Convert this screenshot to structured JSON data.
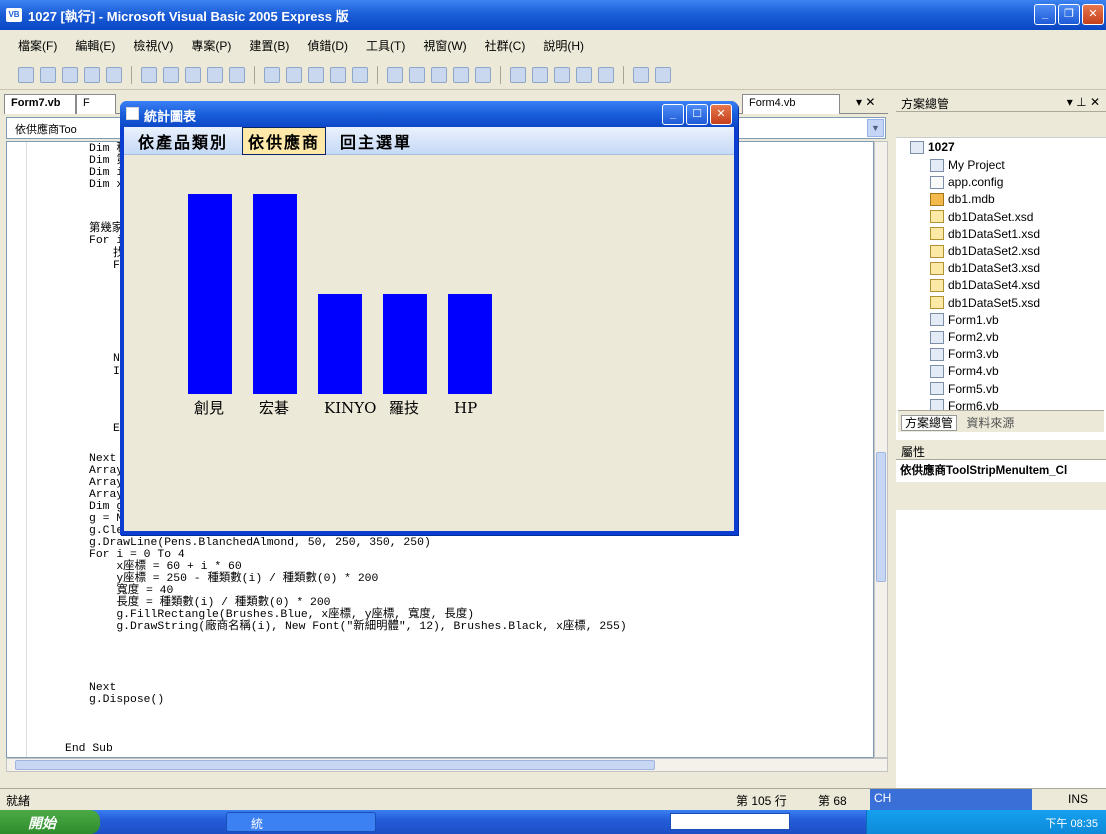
{
  "window": {
    "title": "1027 [執行] - Microsoft Visual Basic 2005 Express 版",
    "icon": "vb-app-icon"
  },
  "menu": [
    "檔案(F)",
    "編輯(E)",
    "檢視(V)",
    "專案(P)",
    "建置(B)",
    "偵錯(D)",
    "工具(T)",
    "視窗(W)",
    "社群(C)",
    "說明(H)"
  ],
  "tabs": {
    "active": "Form7.vb",
    "partial": "F",
    "right": "Form4.vb",
    "pin": "▾ ✕"
  },
  "combo": {
    "value": "依供應商Too"
  },
  "code": {
    "dims": [
      "Dim 種",
      "Dim 第",
      "Dim i",
      "Dim x"
    ],
    "line_count": "第幾家",
    "line_for": "For i",
    "line_inner1": "找",
    "line_inner2": "F",
    "line_n": "N",
    "line_i": "I",
    "line_e": "E",
    "after": [
      "Next",
      "Array",
      "Array",
      "Array",
      "Dim g",
      "g = M"
    ],
    "main": [
      "g.Clear(me.BackColor)",
      "g.DrawLine(Pens.BlanchedAlmond, 50, 250, 350, 250)",
      "For i = 0 To 4",
      "    x座標 = 60 + i * 60",
      "    y座標 = 250 - 種類數(i) / 種類數(0) * 200",
      "    寬度 = 40",
      "    長度 = 種類數(i) / 種類數(0) * 200",
      "    g.FillRectangle(Brushes.Blue, x座標, y座標, 寬度, 長度)",
      "    g.DrawString(廠商名稱(i), New Font(\"新細明體\", 12), Brushes.Black, x座標, 255)"
    ],
    "tail": [
      "Next",
      "g.Dispose()"
    ],
    "end": "End Sub"
  },
  "solution": {
    "header": "方案總管",
    "pin": "▾ ⊥ ✕",
    "root": "1027",
    "items": [
      "My Project",
      "app.config",
      "db1.mdb",
      "db1DataSet.xsd",
      "db1DataSet1.xsd",
      "db1DataSet2.xsd",
      "db1DataSet3.xsd",
      "db1DataSet4.xsd",
      "db1DataSet5.xsd",
      "Form1.vb",
      "Form2.vb",
      "Form3.vb",
      "Form4.vb",
      "Form5.vb",
      "Form6.vb"
    ],
    "tab1": "方案總管",
    "tab2": "資料來源"
  },
  "properties": {
    "header": "屬性",
    "object": "依供應商ToolStripMenuItem_Cl"
  },
  "chart_window": {
    "title": "統計圖表",
    "menu": [
      "依產品類別",
      "依供應商",
      "回主選單"
    ],
    "selected_menu_index": 1
  },
  "chart_data": {
    "type": "bar",
    "categories": [
      "創見",
      "宏碁",
      "KINYO",
      "羅技",
      "HP"
    ],
    "values": [
      100,
      100,
      50,
      50,
      50
    ],
    "ylim": [
      0,
      100
    ],
    "title": "",
    "xlabel": "",
    "ylabel": "",
    "bar_color": "#0000ff"
  },
  "status": {
    "ready": "就緒",
    "line": "第 105 行",
    "col": "第 68",
    "ime": "CH",
    "ins": "INS"
  },
  "taskbar": {
    "start": "開始",
    "task": "統",
    "clock": "下午 08:35"
  }
}
